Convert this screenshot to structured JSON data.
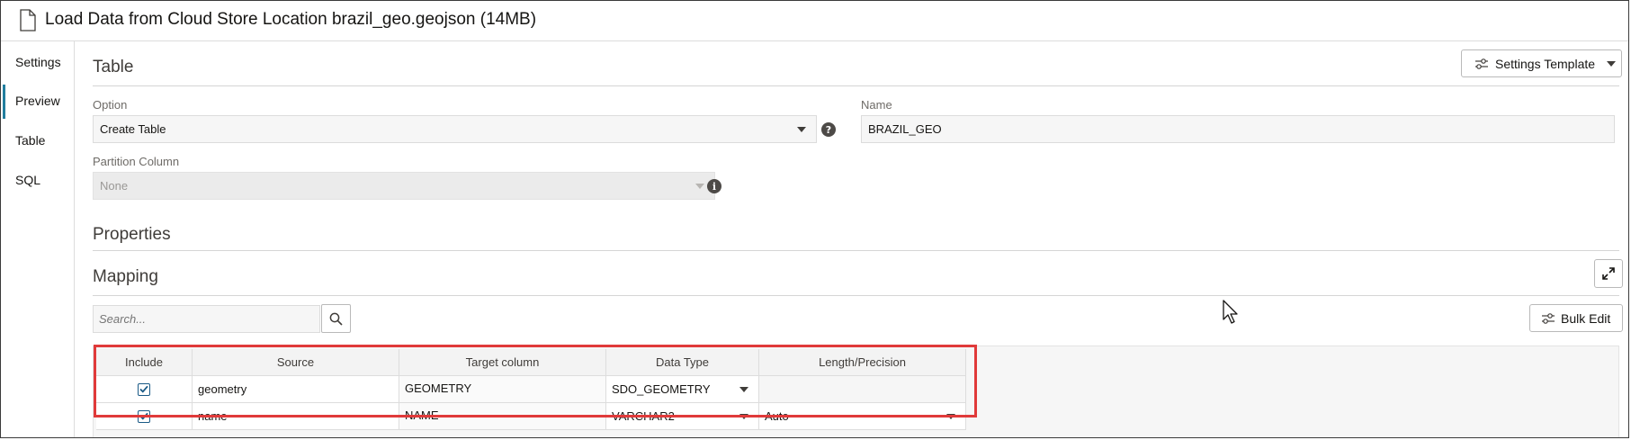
{
  "header": {
    "title": "Load Data from Cloud Store Location brazil_geo.geojson (14MB)"
  },
  "sidebar": {
    "items": [
      {
        "label": "Settings",
        "active": true
      },
      {
        "label": "Preview",
        "active": false
      },
      {
        "label": "Table",
        "active": false
      },
      {
        "label": "SQL",
        "active": false
      }
    ]
  },
  "table_section": {
    "title": "Table",
    "settings_template_label": "Settings Template",
    "option_label": "Option",
    "option_value": "Create Table",
    "name_label": "Name",
    "name_value": "BRAZIL_GEO",
    "partition_label": "Partition Column",
    "partition_value": "None"
  },
  "properties_section": {
    "title": "Properties"
  },
  "mapping_section": {
    "title": "Mapping",
    "search_placeholder": "Search...",
    "bulk_edit_label": "Bulk Edit",
    "columns": [
      "Include",
      "Source",
      "Target column",
      "Data Type",
      "Length/Precision"
    ],
    "rows": [
      {
        "include": true,
        "source": "geometry",
        "target": "GEOMETRY",
        "data_type": "SDO_GEOMETRY",
        "length": ""
      },
      {
        "include": true,
        "source": "name",
        "target": "NAME",
        "data_type": "VARCHAR2",
        "length": "Auto"
      }
    ]
  },
  "colors": {
    "accent": "#227e9e",
    "highlight": "#e03a3a",
    "checkbox": "#1a5a86"
  }
}
